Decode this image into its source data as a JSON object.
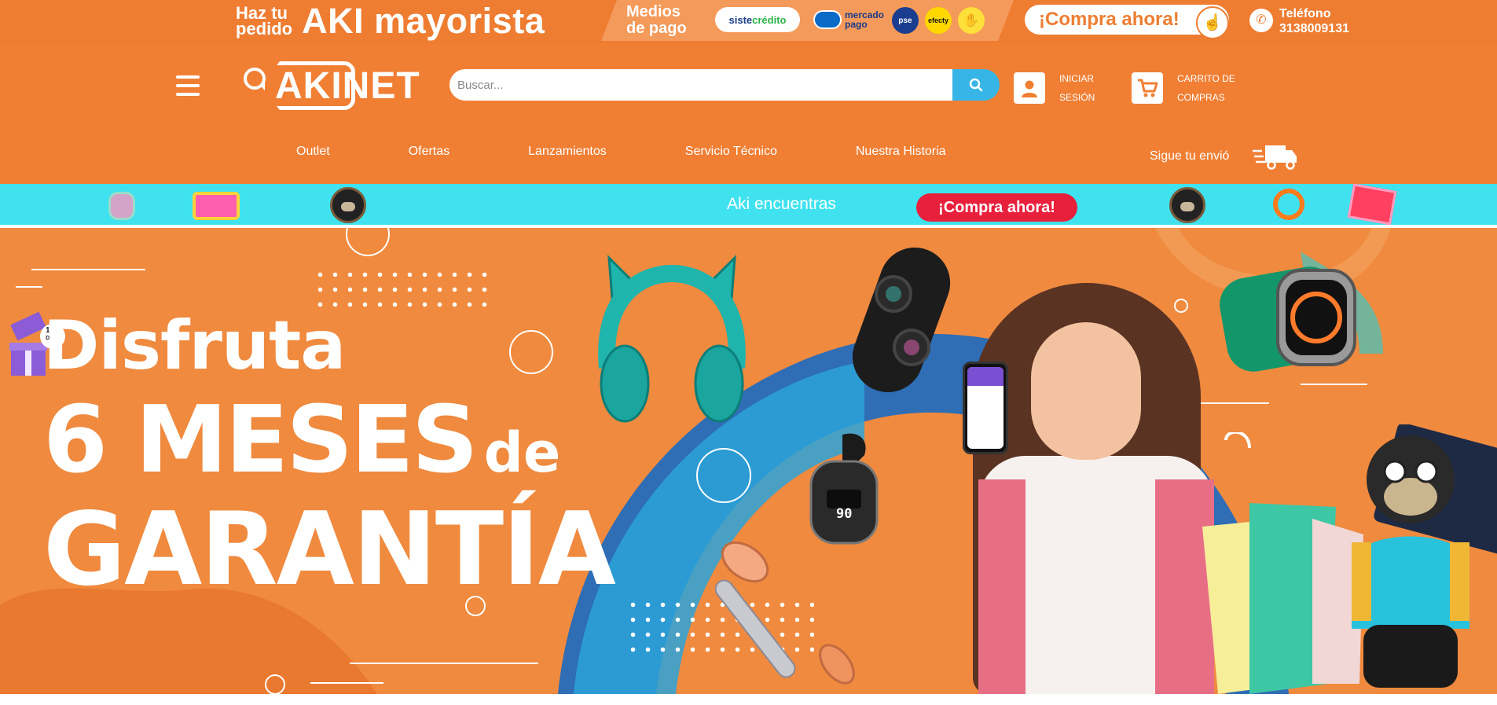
{
  "promo": {
    "small_text_1": "Haz tu",
    "small_text_2": "pedido",
    "big_text": "AKI mayorista",
    "payment_label_1": "Medios",
    "payment_label_2": "de pago",
    "payment_logos": {
      "sistecredito_a": "siste",
      "sistecredito_b": "crédito",
      "mercadopago_1": "mercado",
      "mercadopago_2": "pago",
      "pse": "pse",
      "efecty": "efecty"
    },
    "buy_button": "¡Compra ahora!",
    "phone_label": "Teléfono",
    "phone_number": "3138009131"
  },
  "header": {
    "brand": "AKINET",
    "search_placeholder": "Buscar...",
    "login_line1": "INICIAR",
    "login_line2": "SESIÓN",
    "cart_line1": "CARRITO DE",
    "cart_line2": "COMPRAS",
    "nav": [
      "Outlet",
      "Ofertas",
      "Lanzamientos",
      "Servicio Técnico",
      "Nuestra Historia"
    ],
    "tracking": "Sigue tu envió"
  },
  "ticker": {
    "text": "Aki encuentras",
    "button": "¡Compra ahora!"
  },
  "hero": {
    "line1": "Disfruta",
    "line2_big": "6 MESES",
    "line2_small": "de",
    "line3": "GARANTÍA",
    "gift_badge_1": "10%",
    "gift_badge_2": "DCTO",
    "earbuds_display": "90"
  },
  "colors": {
    "brand_orange": "#f07f34",
    "ticker_cyan": "#3fe2ee",
    "search_blue": "#36b5e6",
    "hero_blue": "#2f6db5",
    "cta_red": "#e8203c"
  }
}
